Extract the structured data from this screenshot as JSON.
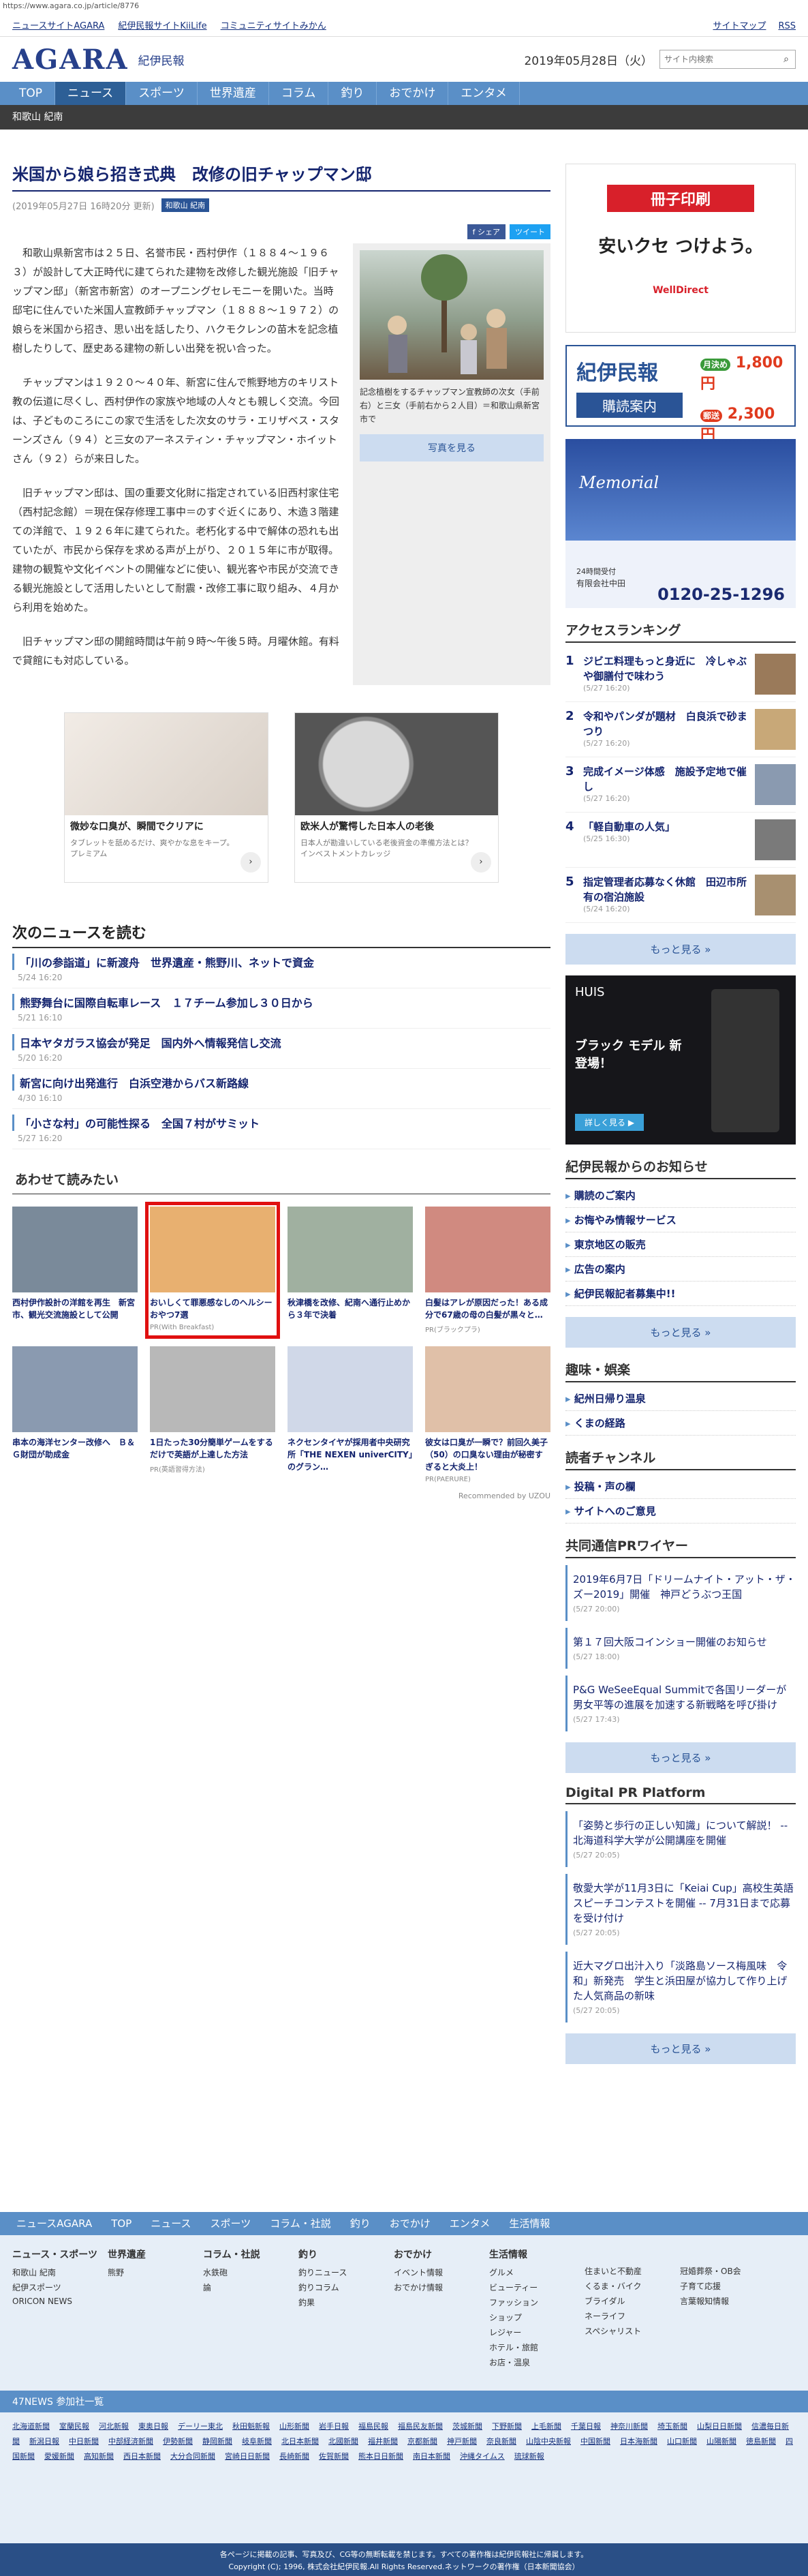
{
  "url": "https://www.agara.co.jp/article/8776",
  "top_links": [
    "ニュースサイトAGARA",
    "紀伊民報サイトKiiLife",
    "コミュニティサイトみかん"
  ],
  "top_right": [
    "サイトマップ",
    "RSS"
  ],
  "logo": "AGARA",
  "logo_sub": "紀伊民報",
  "date": "2019年05月28日（火）",
  "search_placeholder": "サイト内検索",
  "nav": [
    "TOP",
    "ニュース",
    "スポーツ",
    "世界遺産",
    "コラム",
    "釣り",
    "おでかけ",
    "エンタメ"
  ],
  "subnav": "和歌山 紀南",
  "article": {
    "title": "米国から娘ら招き式典　改修の旧チャップマン邸",
    "date": "(2019年05月27日 16時20分 更新)",
    "tag": "和歌山 紀南",
    "share": [
      "f シェア",
      "ツイート"
    ],
    "paras": [
      "和歌山県新宮市は２５日、名誉市民・西村伊作（１８８４～１９６３）が設計して大正時代に建てられた建物を改修した観光施設「旧チャップマン邸」（新宮市新宮）のオープニングセレモニーを開いた。当時邸宅に住んでいた米国人宣教師チャップマン（１８８８～１９７２）の娘らを米国から招き、思い出を話したり、ハクモクレンの苗木を記念植樹したりして、歴史ある建物の新しい出発を祝い合った。",
      "チャップマンは１９２０～４０年、新宮に住んで熊野地方のキリスト教の伝道に尽くし、西村伊作の家族や地域の人々とも親しく交流。今回は、子どものころにこの家で生活をした次女のサラ・エリザベス・スターンズさん（９４）と三女のアーネスティン・チャップマン・ホイットさん（９２）らが来日した。",
      "旧チャップマン邸は、国の重要文化財に指定されている旧西村家住宅（西村記念館）＝現在保存修理工事中＝のすぐ近くにあり、木造３階建ての洋館で、１９２６年に建てられた。老朽化する中で解体の恐れも出ていたが、市民から保存を求める声が上がり、２０１５年に市が取得。建物の観覧や文化イベントの開催などに使い、観光客や市民が交流できる観光施設として活用したいとして耐震・改修工事に取り組み、４月から利用を始めた。",
      "旧チャップマン邸の開館時間は午前９時～午後５時。月曜休館。有料で貸館にも対応している。"
    ],
    "photo_caption": "記念植樹をするチャップマン宣教師の次女（手前右）と三女（手前右から２人目）＝和歌山県新宮市で",
    "photo_button": "写真を見る"
  },
  "ads": [
    {
      "title": "微妙な口臭が、瞬間でクリアに",
      "sub": "タブレットを舐めるだけ、爽やかな息をキープ。",
      "src": "プレミアム"
    },
    {
      "title": "欧米人が驚愕した日本人の老後",
      "sub": "日本人が勘違いしている老後資金の準備方法とは？",
      "src": "インベストメントカレッジ"
    }
  ],
  "next_heading": "次のニュースを読む",
  "next_news": [
    {
      "t": "「川の参詣道」に新渡舟　世界遺産・熊野川、ネットで資金",
      "d": "5/24 16:20"
    },
    {
      "t": "熊野舞台に国際自転車レース　１７チーム参加し３０日から",
      "d": "5/21 16:10"
    },
    {
      "t": "日本ヤタガラス協会が発足　国内外へ情報発信し交流",
      "d": "5/20 16:20"
    },
    {
      "t": "新宮に向け出発進行　白浜空港からバス新路線",
      "d": "4/30 16:10"
    },
    {
      "t": "「小さな村」の可能性探る　全国７村がサミット",
      "d": "5/27 16:20"
    }
  ],
  "also_heading": "あわせて読みたい",
  "also": [
    {
      "t": "西村伊作設計の洋館を再生　新宮市、観光交流施設として公開",
      "s": ""
    },
    {
      "t": "おいしくて罪悪感なしのヘルシーおやつ7選",
      "s": "PR(With Breakfast)"
    },
    {
      "t": "秋津橋を改修、紀南へ通行止めから３年で決着",
      "s": ""
    },
    {
      "t": "白髪はアレが原因だった！ある成分で67歳の母の白髪が黒々と…",
      "s": "PR(ブラックプラ)"
    },
    {
      "t": "串本の海洋センター改修へ　Ｂ＆Ｇ財団が助成金",
      "s": ""
    },
    {
      "t": "1日たった30分簡単ゲームをするだけで英語が上達した方法",
      "s": "PR(英語習得方法)"
    },
    {
      "t": "ネクセンタイヤが採用者中央研究所「THE NEXEN univerCITY」のグラン…",
      "s": ""
    },
    {
      "t": "彼女は口臭が一瞬で？前回久美子（50）の口臭ない理由が秘密すぎると大炎上！",
      "s": "PR(PAERURE)"
    }
  ],
  "recommend": "Recommended by UZOU",
  "side": {
    "ad1": [
      "冊子印刷",
      "安いクセ つけよう。",
      "WellDirect"
    ],
    "sub": {
      "h": "紀伊民報",
      "b": "購読案内",
      "monthly": "月決め",
      "m": "1,800円",
      "post": "郵送",
      "p": "2,300円"
    },
    "ad3": [
      "Memorial",
      "24時間受付",
      "有限会社中田",
      "0120-25-1296"
    ],
    "rank_h": "アクセスランキング",
    "rank": [
      {
        "t": "ジビエ料理もっと身近に　冷しゃぶや御膳付で味わう",
        "d": "(5/27 16:20)"
      },
      {
        "t": "令和やパンダが題材　白良浜で砂まつり",
        "d": "(5/27 16:20)"
      },
      {
        "t": "完成イメージ体感　施設予定地で催し",
        "d": "(5/27 16:20)"
      },
      {
        "t": "「軽自動車の人気」",
        "d": "(5/25 16:30)"
      },
      {
        "t": "指定管理者応募なく休館　田辺市所有の宿泊施設",
        "d": "(5/24 16:20)"
      }
    ],
    "more": "もっと見る »",
    "ad4": [
      "HUIS",
      "ブラック モデル 新登場！",
      "詳しく見る ▶"
    ],
    "notice_h": "紀伊民報からのお知らせ",
    "notice": [
      "購読のご案内",
      "お悔やみ情報サービス",
      "東京地区の販売",
      "広告の案内",
      "紀伊民報記者募集中!!"
    ],
    "hobby_h": "趣味・娯楽",
    "hobby": [
      "紀州日帰り温泉",
      "くまの経路"
    ],
    "reader_h": "読者チャンネル",
    "reader": [
      "投稿・声の欄",
      "サイトへのご意見"
    ],
    "kyodo_h": "共同通信PRワイヤー",
    "kyodo": [
      {
        "t": "2019年6月7日「ドリームナイト・アット・ザ・ズー2019」開催　神戸どうぶつ王国",
        "d": "(5/27 20:00)"
      },
      {
        "t": "第１７回大阪コインショー開催のお知らせ",
        "d": "(5/27 18:00)"
      },
      {
        "t": "P&G WeSeeEqual Summitで各国リーダーが男女平等の進展を加速する新戦略を呼び掛け",
        "d": "(5/27 17:43)"
      }
    ],
    "digital_h": "Digital PR Platform",
    "digital": [
      {
        "t": "「姿勢と歩行の正しい知識」について解説！ -- 北海道科学大学が公開講座を開催",
        "d": "(5/27 20:05)"
      },
      {
        "t": "敬愛大学が11月3日に「Keiai Cup」高校生英語スピーチコンテストを開催 -- 7月31日まで応募を受け付け",
        "d": "(5/27 20:05)"
      },
      {
        "t": "近大マグロ出汁入り「淡路島ソース梅風味　令和」新発売　学生と浜田屋が協力して作り上げた人気商品の新味",
        "d": "(5/27 20:05)"
      }
    ]
  },
  "footer": {
    "nav": [
      "ニュースAGARA",
      "TOP",
      "ニュース",
      "スポーツ",
      "コラム・社説",
      "釣り",
      "おでかけ",
      "エンタメ",
      "生活情報"
    ],
    "cols": [
      {
        "h": "ニュース・スポーツ",
        "i": [
          "和歌山 紀南",
          "紀伊スポーツ",
          "ORICON NEWS"
        ]
      },
      {
        "h": "世界遺産",
        "i": [
          "熊野"
        ]
      },
      {
        "h": "コラム・社説",
        "i": [
          "水鉄砲",
          "論"
        ]
      },
      {
        "h": "釣り",
        "i": [
          "釣りニュース",
          "釣りコラム",
          "釣果"
        ]
      },
      {
        "h": "おでかけ",
        "i": [
          "イベント情報",
          "おでかけ情報"
        ]
      },
      {
        "h": "生活情報",
        "i": [
          "グルメ",
          "ビューティー",
          "ファッション",
          "ショップ",
          "レジャー",
          "ホテル・旅館",
          "お店・温泉"
        ]
      },
      {
        "h": "",
        "i": [
          "住まいと不動産",
          "くるま・バイク",
          "ブライダル",
          "ネーライフ",
          "スペシャリスト"
        ]
      },
      {
        "h": "",
        "i": [
          "冠婚葬祭・OB会",
          "子育て応援",
          "言葉報知情報"
        ]
      }
    ],
    "np_h": "47NEWS 参加社一覧",
    "np": [
      "北海道新聞",
      "室蘭民報",
      "河北新報",
      "東奥日報",
      "デーリー東北",
      "秋田魁新報",
      "山形新聞",
      "岩手日報",
      "福島民報",
      "福島民友新聞",
      "茨城新聞",
      "下野新聞",
      "上毛新聞",
      "千葉日報",
      "神奈川新聞",
      "埼玉新聞",
      "山梨日日新聞",
      "信濃毎日新聞",
      "新潟日報",
      "中日新聞",
      "中部経済新聞",
      "伊勢新聞",
      "静岡新聞",
      "岐阜新聞",
      "北日本新聞",
      "北國新聞",
      "福井新聞",
      "京都新聞",
      "神戸新聞",
      "奈良新聞",
      "山陰中央新報",
      "中国新聞",
      "日本海新聞",
      "山口新聞",
      "山陽新聞",
      "徳島新聞",
      "四国新聞",
      "愛媛新聞",
      "高知新聞",
      "西日本新聞",
      "大分合同新聞",
      "宮崎日日新聞",
      "長崎新聞",
      "佐賀新聞",
      "熊本日日新聞",
      "南日本新聞",
      "沖縄タイムス",
      "琉球新報"
    ],
    "copy1": "各ページに掲載の記事、写真及び、CG等の無断転載を禁じます。すべての著作権は紀伊民報社に帰属します。",
    "copy2": "Copyright (C); 1996, 株式会社紀伊民報.All Rights Reserved.ネットワークの著作権（日本新聞協会）"
  }
}
